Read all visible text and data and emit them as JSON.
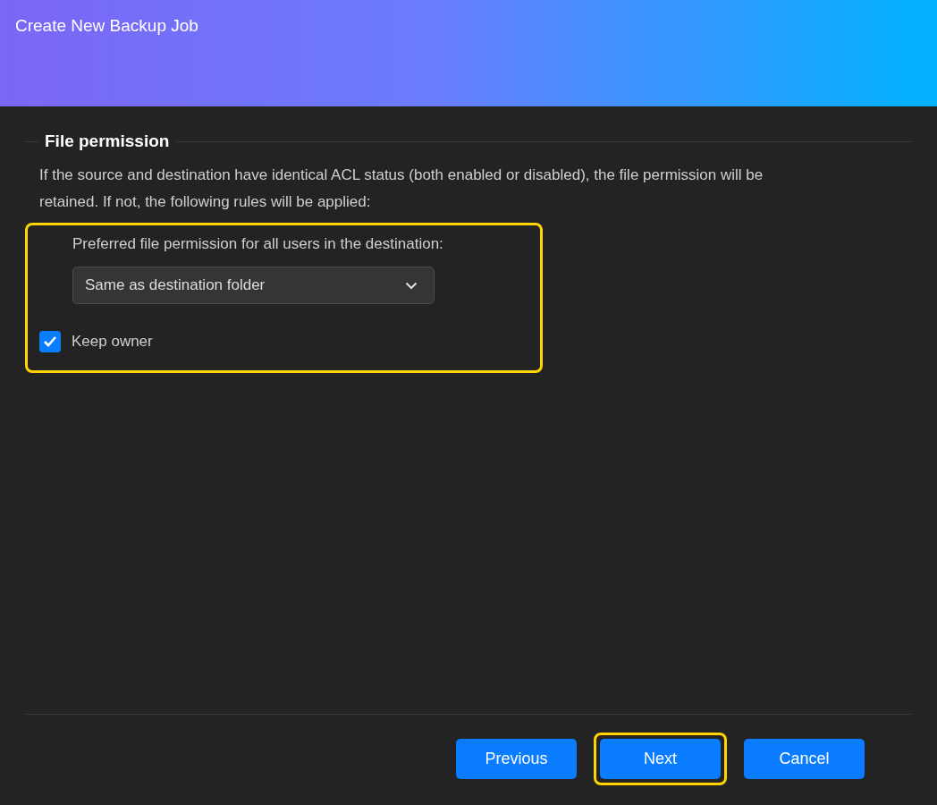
{
  "window": {
    "title": "Create New Backup Job"
  },
  "section": {
    "title": "File permission",
    "description": "If the source and destination have identical ACL status (both enabled or disabled), the file permission will be retained. If not, the following rules will be applied:",
    "group": {
      "highlighted": true,
      "label": "Preferred file permission for all users in the destination:",
      "dropdown": {
        "value": "Same as destination folder"
      },
      "checkbox": {
        "label": "Keep owner",
        "checked": true
      }
    }
  },
  "buttons": [
    {
      "label": "Previous",
      "highlighted": false
    },
    {
      "label": "Next",
      "highlighted": true
    },
    {
      "label": "Cancel",
      "highlighted": false
    }
  ]
}
